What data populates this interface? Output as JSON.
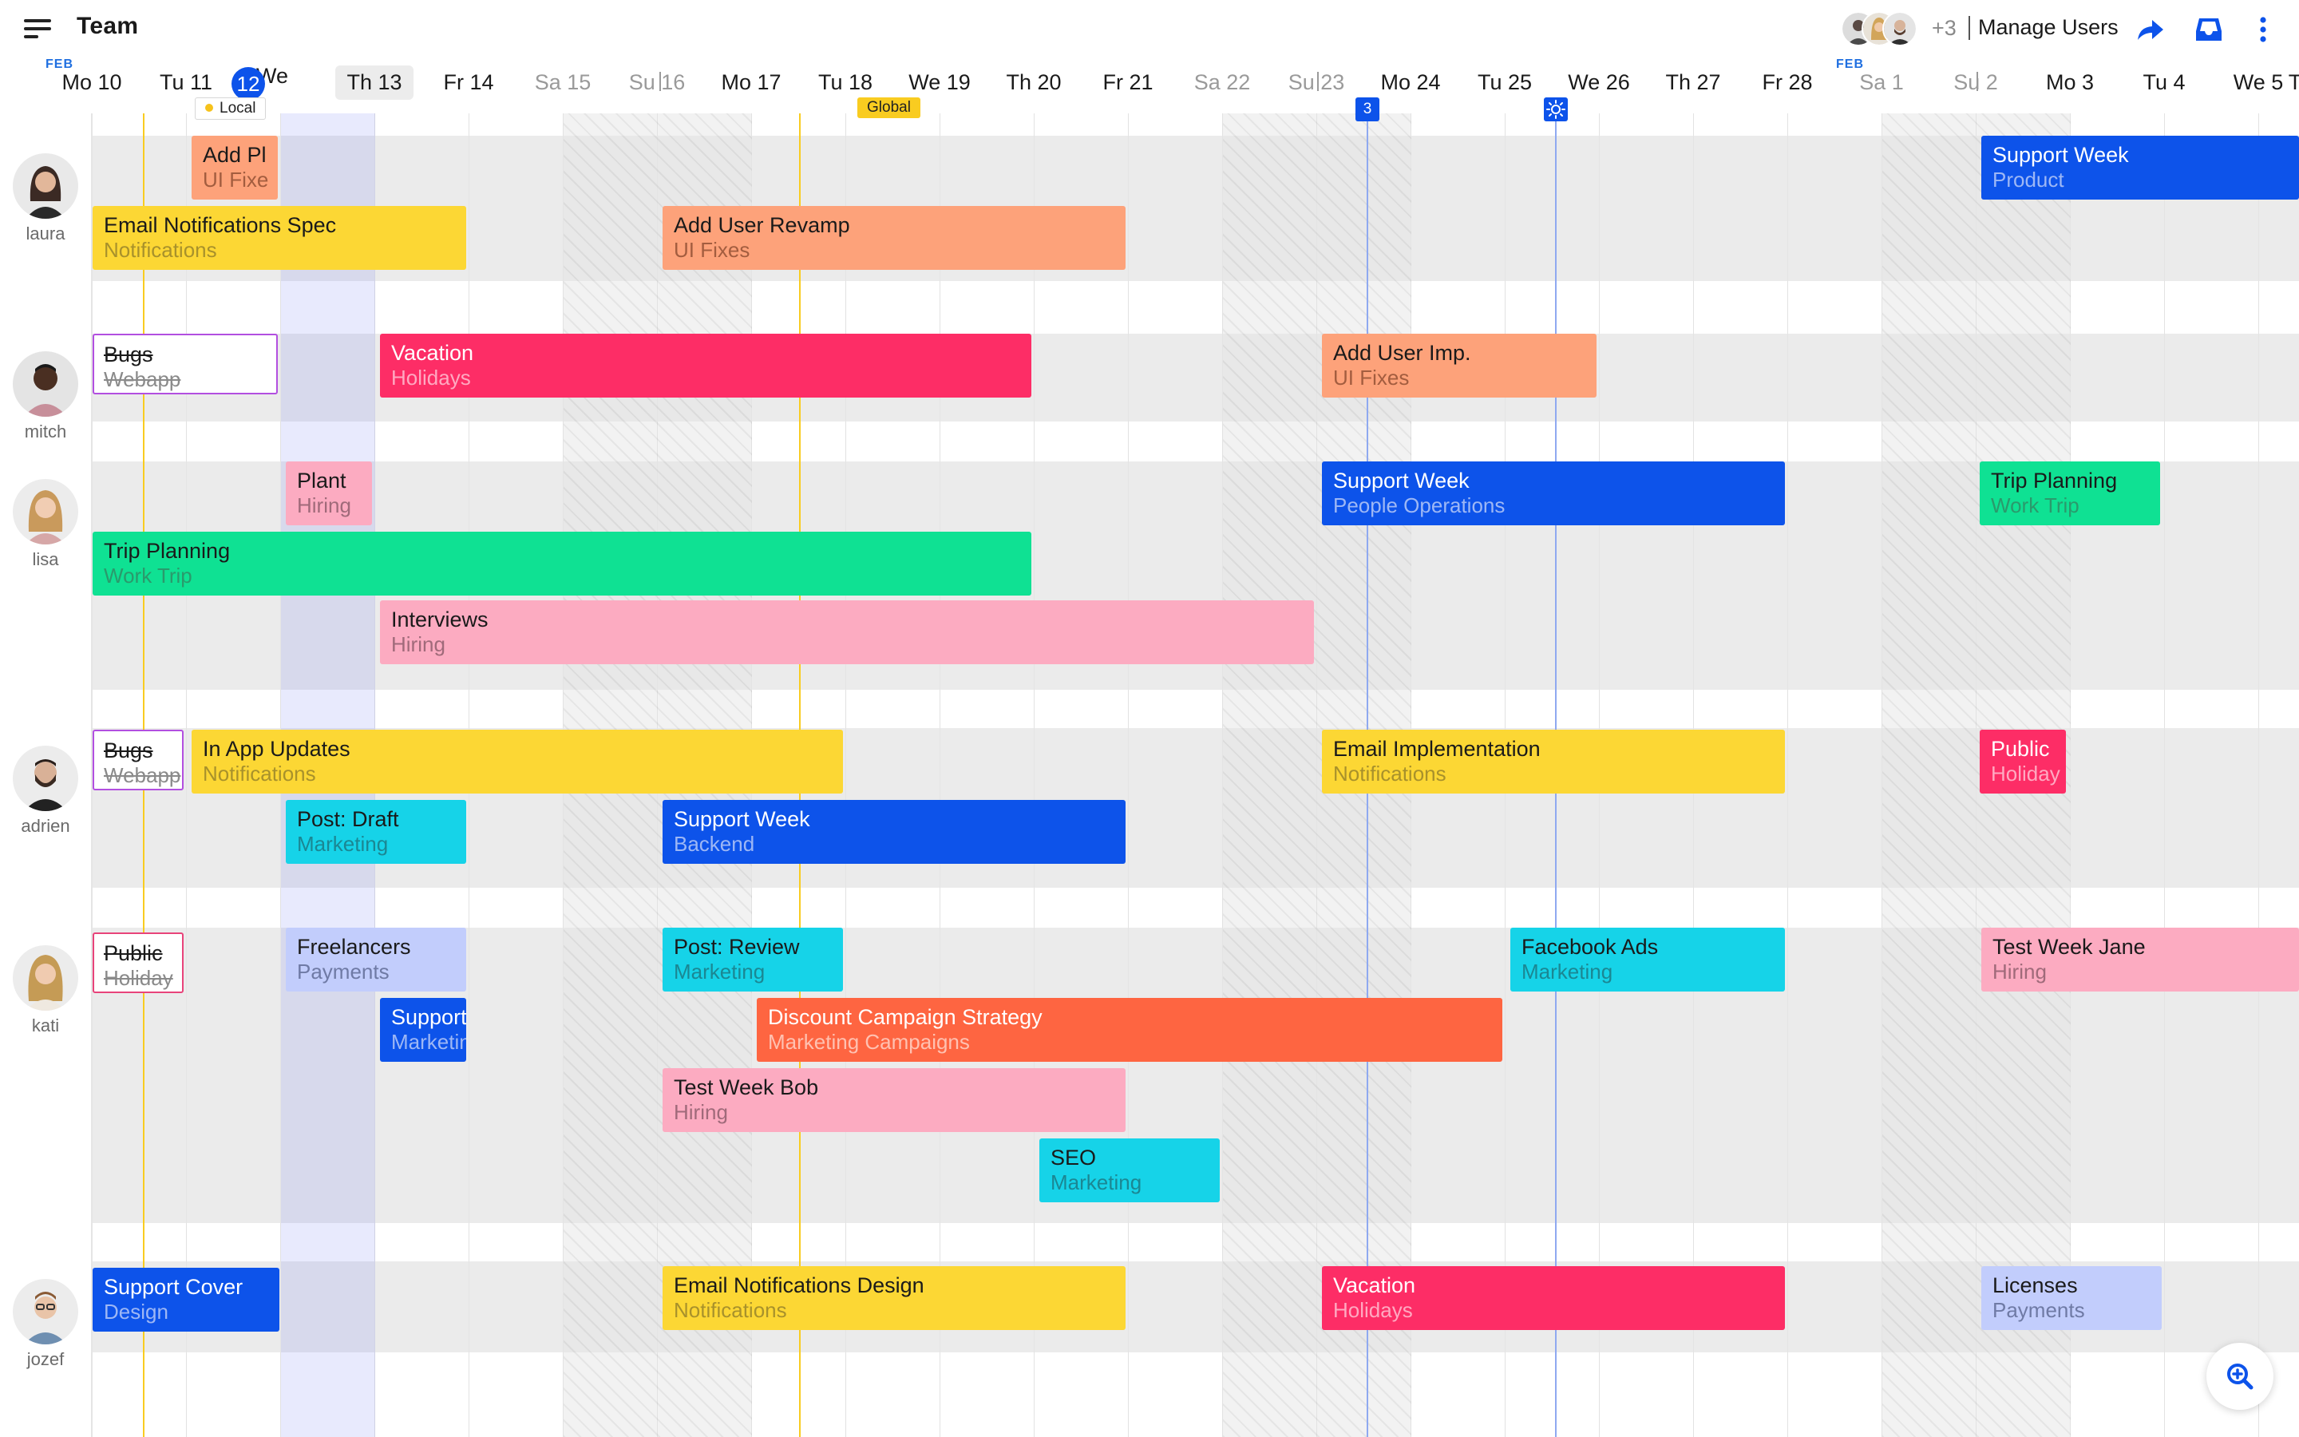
{
  "header": {
    "title": "Team",
    "avatars_overflow": "+3",
    "manage_users": "Manage Users"
  },
  "timeline": {
    "month_label": "FEB",
    "today_label": "12",
    "tags": {
      "local": "Local",
      "global": "Global"
    },
    "marker_count": "3"
  },
  "dates": [
    "Mo 10",
    "Tu 11",
    "We",
    "Th 13",
    "Fr 14",
    "Sa 15",
    "Su 16",
    "Mo 17",
    "Tu 18",
    "We 19",
    "Th 20",
    "Fr 21",
    "Sa 22",
    "Su 23",
    "Mo 24",
    "Tu 25",
    "We 26",
    "Th 27",
    "Fr 28",
    "Sa 1",
    "Su 2",
    "Mo 3",
    "Tu 4",
    "We 5",
    "T"
  ],
  "users": [
    {
      "name": "laura"
    },
    {
      "name": "mitch"
    },
    {
      "name": "lisa"
    },
    {
      "name": "adrien"
    },
    {
      "name": "kati"
    },
    {
      "name": "jozef"
    }
  ],
  "events": [
    {
      "title": "Add Pl",
      "subtitle": "UI Fixe",
      "color": "#fda27a",
      "sub_color": "#a35d3f"
    },
    {
      "title": "Email Notifications Spec",
      "subtitle": "Notifications",
      "color": "#fcd734",
      "sub_color": "#a8912b"
    },
    {
      "title": "Add User Revamp",
      "subtitle": "UI Fixes",
      "color": "#fda27a",
      "sub_color": "#a35d3f"
    },
    {
      "title": "Support Week",
      "subtitle": "Product",
      "color": "#0d53ea",
      "sub_color": "#9db7f5"
    },
    {
      "title": "Bugs",
      "subtitle": "Webapp",
      "color": "#ffffff",
      "sub_color": "#8a8a8a"
    },
    {
      "title": "Vacation",
      "subtitle": "Holidays",
      "color": "#fd2d66",
      "sub_color": "#ffa9c1"
    },
    {
      "title": "Add User Imp.",
      "subtitle": "UI Fixes",
      "color": "#fda27a",
      "sub_color": "#a35d3f"
    },
    {
      "title": "Plant",
      "subtitle": "Hiring",
      "color": "#fcabc1",
      "sub_color": "#a06a7a"
    },
    {
      "title": "Support Week",
      "subtitle": "People Operations",
      "color": "#0d53ea",
      "sub_color": "#9db7f5"
    },
    {
      "title": "Trip Planning",
      "subtitle": "Work Trip",
      "color": "#0fe193",
      "sub_color": "#2a9a6c"
    },
    {
      "title": "Trip Planning",
      "subtitle": "Work Trip",
      "color": "#0fe193",
      "sub_color": "#2a9a6c"
    },
    {
      "title": "Interviews",
      "subtitle": "Hiring",
      "color": "#fcabc1",
      "sub_color": "#a06a7a"
    },
    {
      "title": "Bugs",
      "subtitle": "Webapp",
      "color": "#ffffff",
      "sub_color": "#8a8a8a"
    },
    {
      "title": "In App Updates",
      "subtitle": "Notifications",
      "color": "#fcd734",
      "sub_color": "#a8912b"
    },
    {
      "title": "Email Implementation",
      "subtitle": "Notifications",
      "color": "#fcd734",
      "sub_color": "#a8912b"
    },
    {
      "title": "Public",
      "subtitle": "Holiday",
      "color": "#fd2d66",
      "sub_color": "#ffa9c1"
    },
    {
      "title": "Post: Draft",
      "subtitle": "Marketing",
      "color": "#16d3e8",
      "sub_color": "#1b8793"
    },
    {
      "title": "Support Week",
      "subtitle": "Backend",
      "color": "#0d53ea",
      "sub_color": "#9db7f5"
    },
    {
      "title": "Public",
      "subtitle": "Holiday",
      "color": "#ffffff",
      "sub_color": "#8a8a8a"
    },
    {
      "title": "Freelancers",
      "subtitle": "Payments",
      "color": "#c2cdfc",
      "sub_color": "#6f7aa5"
    },
    {
      "title": "Post: Review",
      "subtitle": "Marketing",
      "color": "#16d3e8",
      "sub_color": "#1b8793"
    },
    {
      "title": "Facebook Ads",
      "subtitle": "Marketing",
      "color": "#16d3e8",
      "sub_color": "#1b8793"
    },
    {
      "title": "Test Week Jane",
      "subtitle": "Hiring",
      "color": "#fcabc1",
      "sub_color": "#a06a7a"
    },
    {
      "title": "Support",
      "subtitle": "Marketing",
      "color": "#0d53ea",
      "sub_color": "#9db7f5"
    },
    {
      "title": "Discount Campaign Strategy",
      "subtitle": "Marketing Campaigns",
      "color": "#fe6541",
      "sub_color": "#ffc1b1"
    },
    {
      "title": "Test Week Bob",
      "subtitle": "Hiring",
      "color": "#fcabc1",
      "sub_color": "#a06a7a"
    },
    {
      "title": "SEO",
      "subtitle": "Marketing",
      "color": "#16d3e8",
      "sub_color": "#1b8793"
    },
    {
      "title": "Support Cover",
      "subtitle": "Design",
      "color": "#0d53ea",
      "sub_color": "#9db7f5"
    },
    {
      "title": "Email Notifications Design",
      "subtitle": "Notifications",
      "color": "#fcd734",
      "sub_color": "#a8912b"
    },
    {
      "title": "Vacation",
      "subtitle": "Holidays",
      "color": "#fd2d66",
      "sub_color": "#ffa9c1"
    },
    {
      "title": "Licenses",
      "subtitle": "Payments",
      "color": "#c2cdfc",
      "sub_color": "#6f7aa5"
    }
  ],
  "colors": {
    "accent": "#0d53ea",
    "today_column": "#e6e8fd",
    "global_line": "#f9cc20"
  }
}
